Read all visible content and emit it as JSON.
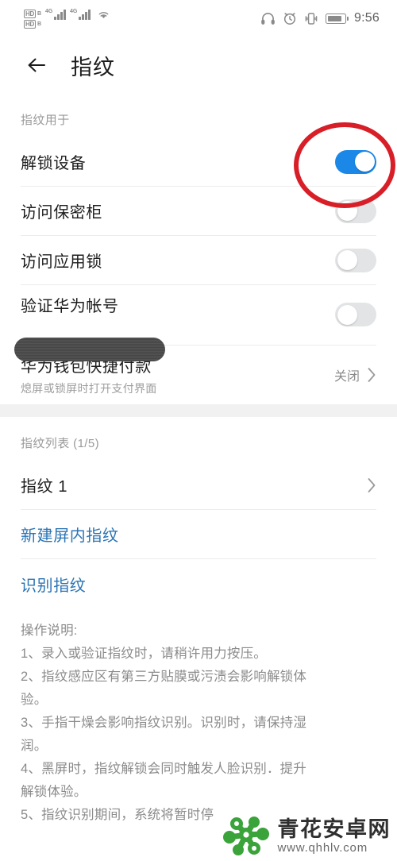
{
  "statusbar": {
    "volte_label": "HD",
    "volte_sub": "B",
    "network_1": "4G",
    "network_2": "4G",
    "wifi_icon": "wifi-icon",
    "headphone_icon": "headphone-icon",
    "alarm_icon": "alarm-icon",
    "vibrate_icon": "vibrate-icon",
    "battery_icon": "battery-icon",
    "time": "9:56"
  },
  "header": {
    "back_icon": "back-arrow-icon",
    "title": "指纹"
  },
  "fingerprint_usage": {
    "section_label": "指纹用于",
    "items": [
      {
        "label": "解锁设备",
        "state": "on",
        "highlighted": true
      },
      {
        "label": "访问保密柜",
        "state": "off",
        "highlighted": false
      },
      {
        "label": "访问应用锁",
        "state": "off",
        "highlighted": false
      },
      {
        "label": "验证华为帐号",
        "state": "off",
        "highlighted": false
      }
    ],
    "wallet": {
      "label": "华为钱包快捷付款",
      "sublabel": "熄屏或锁屏时打开支付界面",
      "value": "关闭",
      "chevron_icon": "chevron-right-icon"
    }
  },
  "fingerprint_list": {
    "section_label": "指纹列表 (1/5)",
    "items": [
      {
        "label": "指纹 1",
        "chevron_icon": "chevron-right-icon"
      }
    ],
    "actions": [
      {
        "label": "新建屏内指纹"
      },
      {
        "label": "识别指纹"
      }
    ]
  },
  "instructions": {
    "title": "操作说明:",
    "lines": [
      "1、录入或验证指纹时，请稍许用力按压。",
      "2、指纹感应区有第三方贴膜或污渍会影响解锁体",
      "验。",
      "3、手指干燥会影响指纹识别。识别时，请保持湿",
      "润。",
      "4、黑屏时，指纹解锁会同时触发人脸识别．提升",
      "解锁体验。",
      "5、指纹识别期间，系统将暂时停"
    ]
  },
  "annotation": {
    "shape": "ellipse",
    "color": "#d81f28",
    "target": "解锁设备 toggle"
  },
  "watermark": {
    "logo_icon": "qinghua-logo-icon",
    "title": "青花安卓网",
    "url": "www.qhhlv.com",
    "color": "#3aa33a"
  },
  "colors": {
    "toggle_on": "#1b88e8",
    "toggle_off": "#e3e4e6",
    "link_blue": "#2b74b4",
    "annotation_red": "#d81f28",
    "watermark_green": "#3aa33a"
  }
}
